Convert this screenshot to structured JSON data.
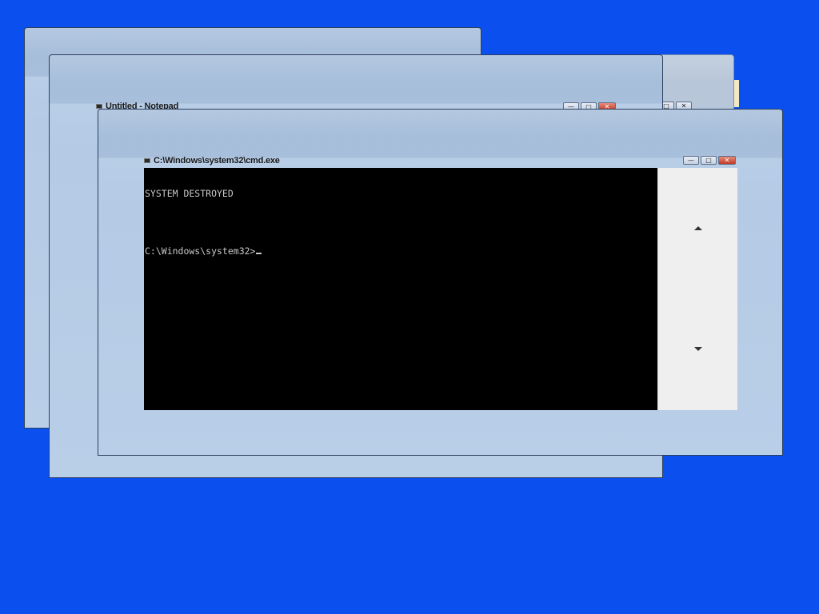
{
  "desktop": {
    "background_color": "#0b50ee"
  },
  "notepad_window": {
    "title": "Untitled - Notepad",
    "controls": {
      "minimize": "—",
      "maximize": "□",
      "close": "✕"
    }
  },
  "background_window": {
    "controls": {
      "maximize": "□",
      "close": "✕"
    }
  },
  "cmd_window": {
    "title": "C:\\Windows\\system32\\cmd.exe",
    "controls": {
      "minimize": "—",
      "maximize": "□",
      "close": "✕"
    },
    "console": {
      "lines": [
        "SYSTEM DESTROYED",
        "",
        "C:\\Windows\\system32>"
      ]
    },
    "scrollbar": {
      "up_icon": "arrow-up-icon",
      "down_icon": "arrow-down-icon"
    }
  }
}
